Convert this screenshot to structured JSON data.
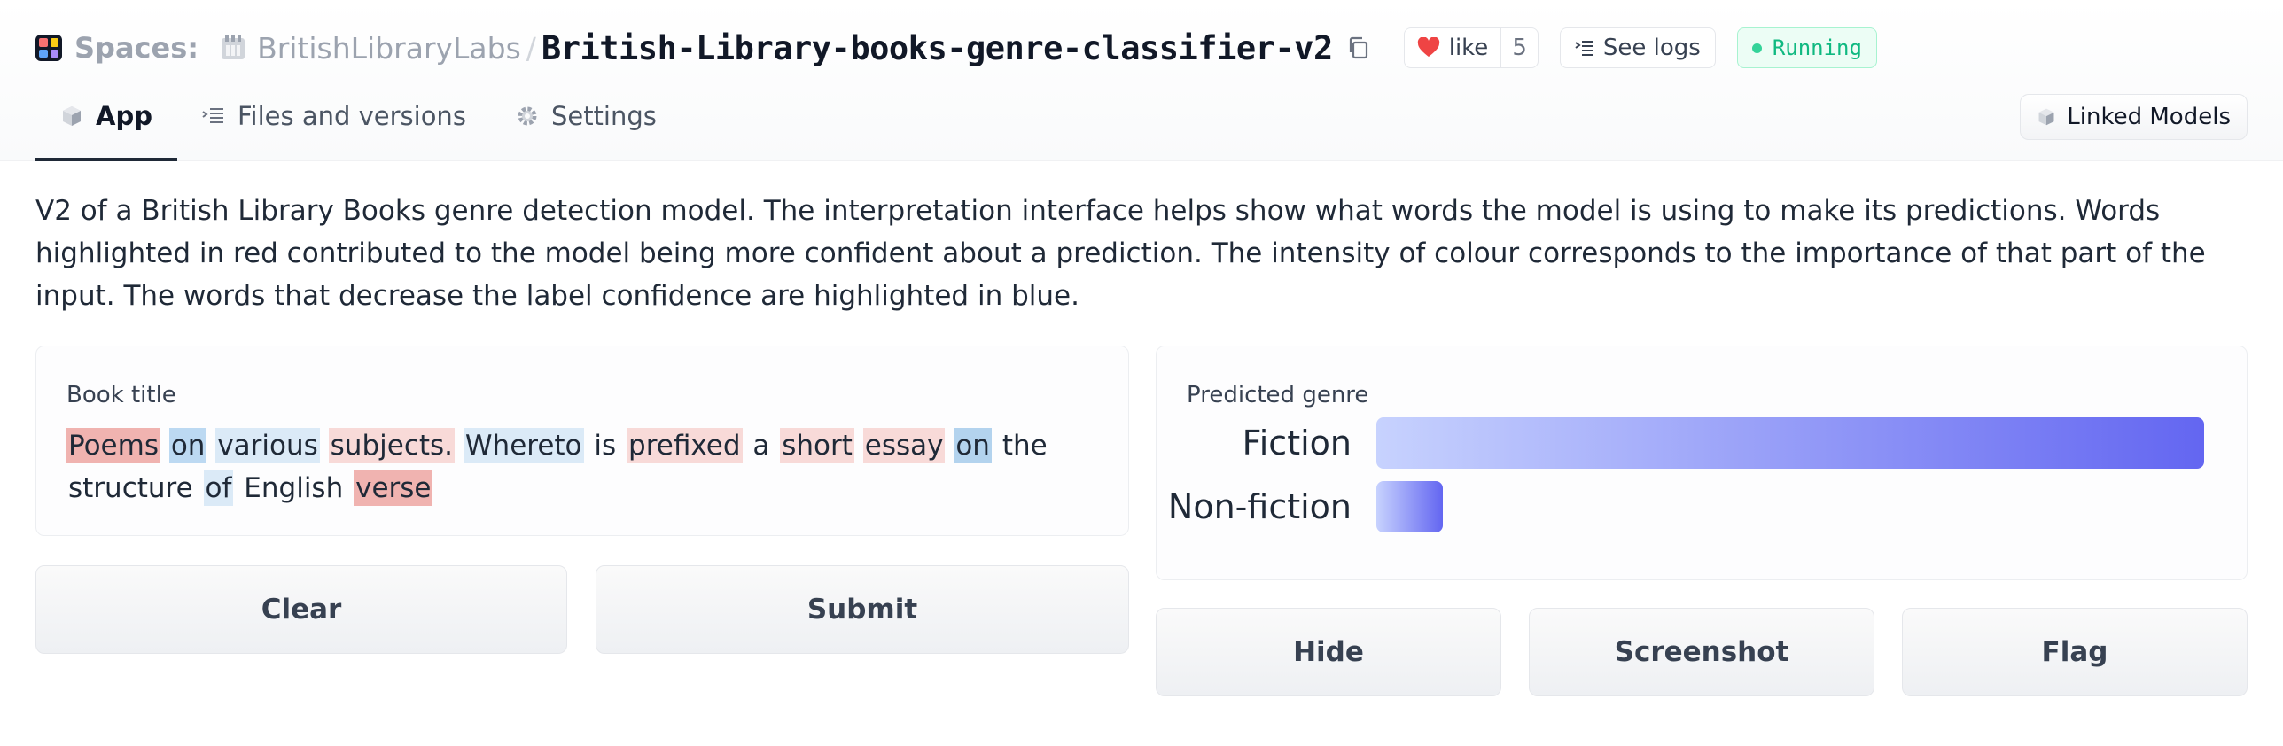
{
  "header": {
    "spaces_label": "Spaces:",
    "org": "BritishLibraryLabs",
    "separator": "/",
    "repo": "British-Library-books-genre-classifier-v2",
    "like_label": "like",
    "like_count": "5",
    "logs_label": "See logs",
    "status": "Running",
    "icons": [
      "spaces-logo-icon",
      "org-avatar-icon",
      "copy-icon",
      "heart-icon",
      "logs-icon",
      "status-dot-icon"
    ]
  },
  "tabs": [
    {
      "label": "App",
      "icon": "cube-icon",
      "active": true
    },
    {
      "label": "Files and versions",
      "icon": "files-icon",
      "active": false
    },
    {
      "label": "Settings",
      "icon": "gear-icon",
      "active": false
    }
  ],
  "linked_models_label": "Linked Models",
  "description": "V2 of a British Library Books genre detection model. The interpretation interface helps show what words the model is using to make its predictions. Words highlighted in red contributed to the model being more confident about a prediction. The intensity of colour corresponds to the importance of that part of the input. The words that decrease the label confidence are highlighted in blue.",
  "input": {
    "label": "Book title",
    "tokens": [
      {
        "text": "Poems",
        "color": "#f0b3b0"
      },
      {
        "text": "on",
        "color": "#bcd9f2"
      },
      {
        "text": "various",
        "color": "#dbeaf7"
      },
      {
        "text": "subjects.",
        "color": "#f8dad8"
      },
      {
        "text": "Whereto",
        "color": "#dbeaf7"
      },
      {
        "text": "is",
        "color": ""
      },
      {
        "text": "prefixed",
        "color": "#f8dad8"
      },
      {
        "text": "a",
        "color": ""
      },
      {
        "text": "short",
        "color": "#f8dad8"
      },
      {
        "text": "essay",
        "color": "#f8dad8"
      },
      {
        "text": "on",
        "color": "#b3d3ee"
      },
      {
        "text": "the",
        "color": ""
      },
      {
        "text": "structure",
        "color": ""
      },
      {
        "text": "of",
        "color": "#dbeaf7"
      },
      {
        "text": "English",
        "color": ""
      },
      {
        "text": "verse",
        "color": "#f0b3b0"
      }
    ]
  },
  "output": {
    "label": "Predicted genre",
    "predictions": [
      {
        "label": "Fiction",
        "confidence": 0.93
      },
      {
        "label": "Non-fiction",
        "confidence": 0.07
      }
    ],
    "bar_color_start": "#c7d2fe",
    "bar_color_end": "#6366f1"
  },
  "buttons": {
    "clear": "Clear",
    "submit": "Submit",
    "hide": "Hide",
    "screenshot": "Screenshot",
    "flag": "Flag"
  }
}
